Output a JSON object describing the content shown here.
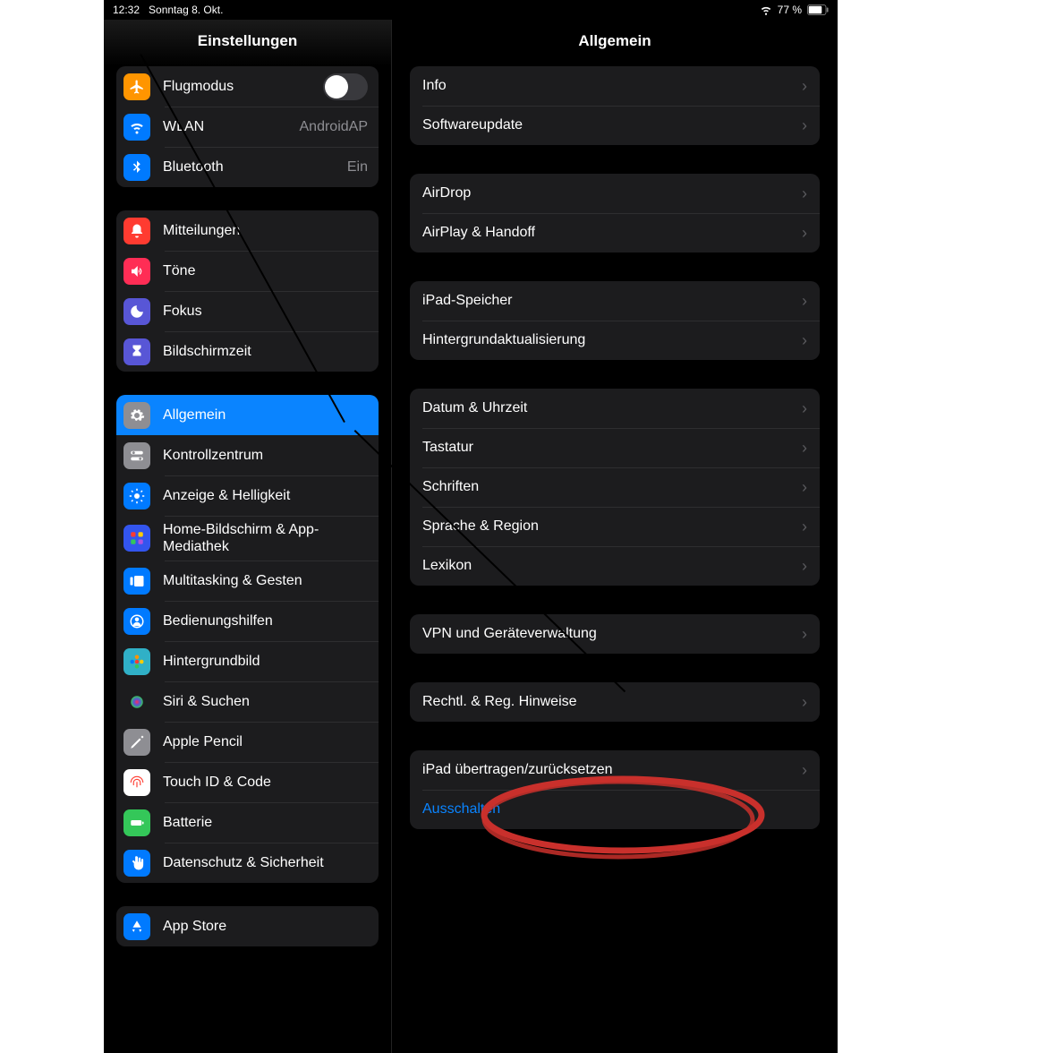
{
  "statusbar": {
    "time": "12:32",
    "date": "Sonntag 8. Okt.",
    "battery": "77 %"
  },
  "sidebar": {
    "title": "Einstellungen",
    "groups": [
      {
        "items": [
          {
            "key": "airplane",
            "label": "Flugmodus",
            "icon": "airplane",
            "bg": "#ff9500",
            "toggle": true
          },
          {
            "key": "wlan",
            "label": "WLAN",
            "icon": "wifi",
            "bg": "#007aff",
            "detail": "AndroidAP"
          },
          {
            "key": "bluetooth",
            "label": "Bluetooth",
            "icon": "bluetooth",
            "bg": "#007aff",
            "detail": "Ein"
          }
        ]
      },
      {
        "items": [
          {
            "key": "notifications",
            "label": "Mitteilungen",
            "icon": "bell",
            "bg": "#ff3b30"
          },
          {
            "key": "sounds",
            "label": "Töne",
            "icon": "speaker",
            "bg": "#ff2d55"
          },
          {
            "key": "focus",
            "label": "Fokus",
            "icon": "moon",
            "bg": "#5856d6"
          },
          {
            "key": "screentime",
            "label": "Bildschirmzeit",
            "icon": "hourglass",
            "bg": "#5856d6"
          }
        ]
      },
      {
        "items": [
          {
            "key": "general",
            "label": "Allgemein",
            "icon": "gear",
            "bg": "#8e8e93",
            "selected": true
          },
          {
            "key": "controlcenter",
            "label": "Kontrollzentrum",
            "icon": "switches",
            "bg": "#8e8e93"
          },
          {
            "key": "display",
            "label": "Anzeige & Helligkeit",
            "icon": "sunburst",
            "bg": "#007aff"
          },
          {
            "key": "homescreen",
            "label": "Home-Bildschirm & App-Mediathek",
            "icon": "grid",
            "bg": "#3355ee"
          },
          {
            "key": "multitasking",
            "label": "Multitasking & Gesten",
            "icon": "stage",
            "bg": "#007aff"
          },
          {
            "key": "accessibility",
            "label": "Bedienungshilfen",
            "icon": "person",
            "bg": "#007aff"
          },
          {
            "key": "wallpaper",
            "label": "Hintergrundbild",
            "icon": "flower",
            "bg": "#30b0c7"
          },
          {
            "key": "siri",
            "label": "Siri & Suchen",
            "icon": "siri",
            "bg": "#1c1c1e"
          },
          {
            "key": "pencil",
            "label": "Apple Pencil",
            "icon": "pencil",
            "bg": "#8e8e93"
          },
          {
            "key": "touchid",
            "label": "Touch ID & Code",
            "icon": "fingerprint",
            "bg": "#ffffff"
          },
          {
            "key": "battery",
            "label": "Batterie",
            "icon": "battery",
            "bg": "#34c759"
          },
          {
            "key": "privacy",
            "label": "Datenschutz & Sicherheit",
            "icon": "hand",
            "bg": "#007aff"
          }
        ]
      },
      {
        "items": [
          {
            "key": "appstore",
            "label": "App Store",
            "icon": "appstore",
            "bg": "#007aff"
          }
        ]
      }
    ]
  },
  "detail": {
    "title": "Allgemein",
    "groups": [
      {
        "items": [
          {
            "key": "info",
            "label": "Info"
          },
          {
            "key": "softwareupdate",
            "label": "Softwareupdate"
          }
        ]
      },
      {
        "items": [
          {
            "key": "airdrop",
            "label": "AirDrop"
          },
          {
            "key": "airplay",
            "label": "AirPlay & Handoff"
          }
        ]
      },
      {
        "items": [
          {
            "key": "storage",
            "label": "iPad-Speicher"
          },
          {
            "key": "bgrefresh",
            "label": "Hintergrundaktualisierung"
          }
        ]
      },
      {
        "items": [
          {
            "key": "datetime",
            "label": "Datum & Uhrzeit"
          },
          {
            "key": "keyboard",
            "label": "Tastatur"
          },
          {
            "key": "fonts",
            "label": "Schriften"
          },
          {
            "key": "language",
            "label": "Sprache & Region"
          },
          {
            "key": "dictionary",
            "label": "Lexikon"
          }
        ]
      },
      {
        "items": [
          {
            "key": "vpn",
            "label": "VPN und Geräteverwaltung"
          }
        ]
      },
      {
        "items": [
          {
            "key": "legal",
            "label": "Rechtl. & Reg. Hinweise"
          }
        ]
      },
      {
        "items": [
          {
            "key": "transfer",
            "label": "iPad übertragen/zurücksetzen"
          },
          {
            "key": "shutdown",
            "label": "Ausschalten",
            "action": true,
            "nochevron": true
          }
        ]
      }
    ]
  }
}
